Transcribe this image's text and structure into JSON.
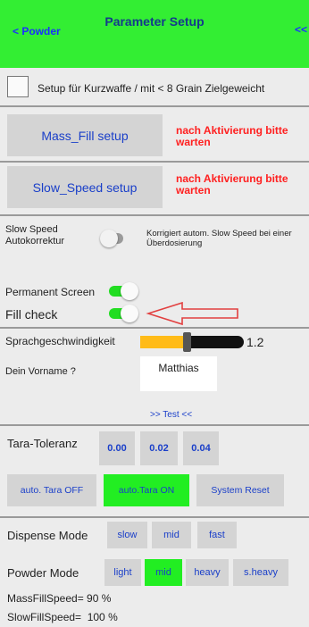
{
  "header": {
    "back_label": "< Powder",
    "title": "Parameter Setup",
    "forward_label": "<<"
  },
  "short_weapon": {
    "label": "Setup für Kurzwaffe / mit < 8 Grain Zielgeweicht",
    "checked": false
  },
  "mass_fill": {
    "button": "Mass_Fill  setup",
    "note": "nach Aktivierung bitte warten"
  },
  "slow_speed": {
    "button": "Slow_Speed setup",
    "note": "nach Aktivierung bitte warten"
  },
  "autokorrektur": {
    "label": "Slow Speed Autokorrektur",
    "desc": "Korrigiert autom. Slow Speed bei einer Überdosierung",
    "on": false
  },
  "permanent_screen": {
    "label": "Permanent Screen",
    "on": true
  },
  "fill_check": {
    "label": "Fill check",
    "on": true
  },
  "speech": {
    "label": "Sprachgeschwindigkeit",
    "value": "1.2",
    "fill_fraction": 0.45
  },
  "name": {
    "label": "Dein Vorname ?",
    "value": "Matthias"
  },
  "test_link": ">> Test <<",
  "tara": {
    "label": "Tara-Toleranz",
    "options": [
      "0.00",
      "0.02",
      "0.04"
    ]
  },
  "tara_buttons": {
    "off": "auto. Tara OFF",
    "on": "auto.Tara ON",
    "reset": "System Reset"
  },
  "dispense": {
    "label": "Dispense Mode",
    "options": [
      "slow",
      "mid",
      "fast"
    ]
  },
  "powder": {
    "label": "Powder Mode",
    "options": [
      "light",
      "mid",
      "heavy",
      "s.heavy"
    ],
    "selected": "mid"
  },
  "speeds": {
    "mass": "MassFillSpeed= 90 %",
    "slow": "SlowFillSpeed=  100 %"
  },
  "colors": {
    "header": "#33ee33",
    "accent": "#22ee22",
    "warning": "#ff2020",
    "link": "#1a3fc9"
  }
}
